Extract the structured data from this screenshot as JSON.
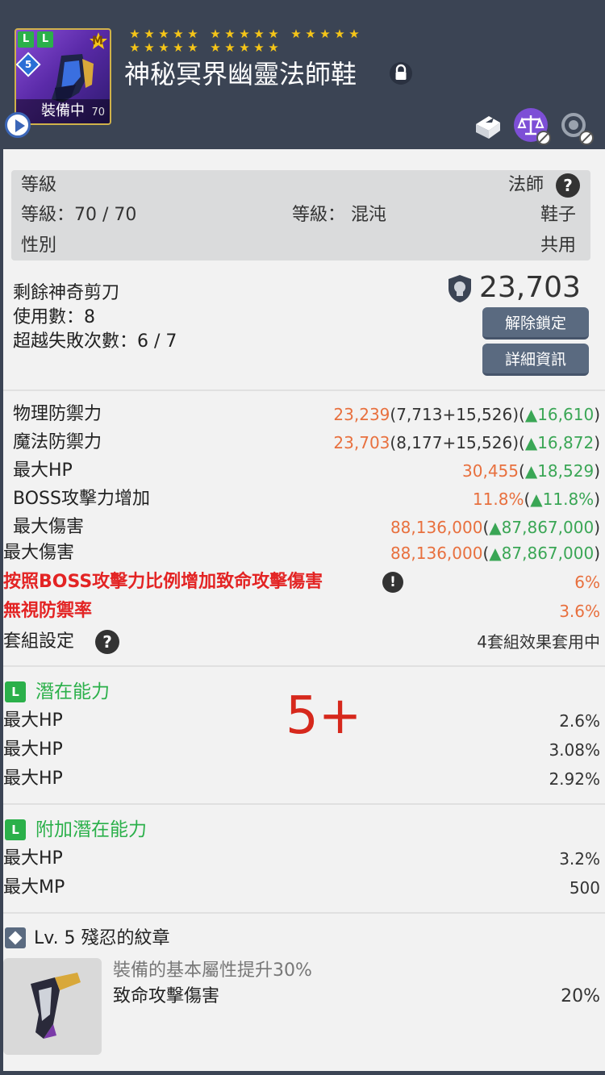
{
  "item": {
    "name": "神秘冥界幽靈法師鞋",
    "badge_l1": "L",
    "badge_l2": "L",
    "badge_m": "M",
    "badge_level": "5",
    "equipped_label": "裝備中",
    "equipped_level": "70",
    "stars_rows": [
      15,
      10
    ],
    "icon_colors": {
      "header_bg": "#3b4454",
      "item_bg": "#7d4fd6"
    }
  },
  "header_icons": [
    "play-icon",
    "lock-icon",
    "transfer-icon",
    "scale-icon",
    "reset-icon"
  ],
  "requirements": {
    "level_label": "等級",
    "class": "法師",
    "level_value": "等級：70 / 70",
    "grade": "等級： 混沌",
    "type": "鞋子",
    "gender_label": "性別",
    "gender": "共用"
  },
  "scissors": {
    "label": "剩餘神奇剪刀",
    "uses": "使用數：8",
    "fail": "超越失敗次數：6 / 7",
    "price": "23,703",
    "unlock_button": "解除鎖定",
    "detail_button": "詳細資訊"
  },
  "stats": [
    {
      "label": "物理防禦力",
      "total": "23,239",
      "detail": "(7,713+15,526)(",
      "delta": "▲16,610",
      "close": ")"
    },
    {
      "label": "魔法防禦力",
      "total": "23,703",
      "detail": "(8,177+15,526)(",
      "delta": "▲16,872",
      "close": ")"
    },
    {
      "label": "最大HP",
      "total": "30,455",
      "detail": "(",
      "delta": "▲18,529",
      "close": ")"
    },
    {
      "label": "BOSS攻擊力增加",
      "total": "11.8%",
      "detail": "(",
      "delta": "▲11.8%",
      "close": ")"
    },
    {
      "label": "最大傷害",
      "total": "88,136,000",
      "detail": "(",
      "delta": "▲87,867,000",
      "close": ")"
    },
    {
      "label": "最大傷害",
      "total": "88,136,000",
      "detail": "(",
      "delta": "▲87,867,000",
      "close": ")"
    }
  ],
  "special_stats": [
    {
      "label": "按照BOSS攻擊力比例增加致命攻擊傷害",
      "value": "6%"
    },
    {
      "label": "無視防禦率",
      "value": "3.6%"
    }
  ],
  "set": {
    "label": "套組設定",
    "value": "4套組效果套用中"
  },
  "potential": {
    "badge": "L",
    "title": "潛在能力",
    "lines": [
      {
        "label": "最大HP",
        "value": "2.6%"
      },
      {
        "label": "最大HP",
        "value": "3.08%"
      },
      {
        "label": "最大HP",
        "value": "2.92%"
      }
    ],
    "annotation": "5+"
  },
  "additional": {
    "badge": "L",
    "title": "附加潛在能力",
    "lines": [
      {
        "label": "最大HP",
        "value": "3.2%"
      },
      {
        "label": "最大MP",
        "value": "500"
      }
    ]
  },
  "emblem": {
    "title": "Lv. 5 殘忍的紋章",
    "desc": "裝備的基本屬性提升30%",
    "stat_label": "致命攻擊傷害",
    "stat_value": "20%"
  }
}
